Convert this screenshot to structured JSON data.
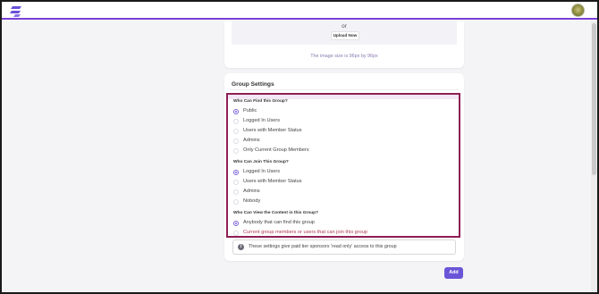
{
  "header": {
    "logo_icon": "brand-slash-logo",
    "avatar_icon": "user-avatar",
    "accent": "#7b3fd6"
  },
  "image_upload": {
    "or_text": "or",
    "upload_button": "Upload Now",
    "size_note": "The image size is 96px by 96px"
  },
  "group_settings": {
    "title": "Group Settings",
    "find": {
      "title": "Who Can Find this Group?",
      "options": [
        "Public",
        "Logged In Users",
        "Users with Member Status",
        "Admins",
        "Only Current Group Members"
      ],
      "selected": "Public"
    },
    "join": {
      "title": "Who Can Join This Group?",
      "options": [
        "Logged In Users",
        "Users with Member Status",
        "Admins",
        "Nobody"
      ],
      "selected": "Logged In Users"
    },
    "view": {
      "title": "Who Can View the Content in this Group?",
      "options": [
        "Anybody that can find this group",
        "Current group members or users that can join this group"
      ],
      "selected": "Anybody that can find this group"
    },
    "info": "These settings give paid tier sponsors 'read only' access to this group",
    "highlight_color": "#8e1f55"
  },
  "actions": {
    "add_button": "Add",
    "button_color": "#6a55d8"
  }
}
